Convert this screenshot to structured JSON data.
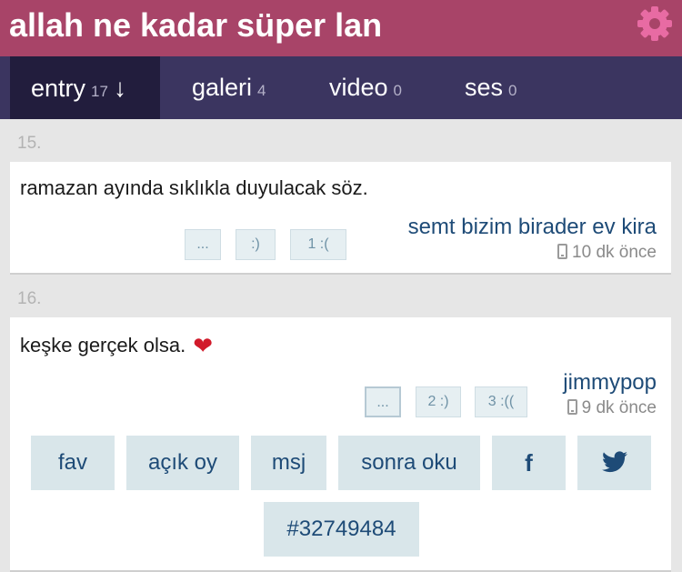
{
  "header": {
    "title": "allah ne kadar süper lan"
  },
  "tabs": [
    {
      "label": "entry",
      "count": "17",
      "arrow": "↓"
    },
    {
      "label": "galeri",
      "count": "4"
    },
    {
      "label": "video",
      "count": "0"
    },
    {
      "label": "ses",
      "count": "0"
    }
  ],
  "entries": [
    {
      "number": "15.",
      "text": "ramazan ayında sıklıkla duyulacak söz.",
      "votes": [
        "...",
        ":)",
        "1  :("
      ],
      "author": "semt bizim birader ev kira",
      "time": "10 dk önce"
    },
    {
      "number": "16.",
      "text": "keşke gerçek olsa.",
      "votes": [
        "...",
        "2 :)",
        "3 :(("
      ],
      "author": "jimmypop",
      "time": "9 dk önce",
      "actions": {
        "fav": "fav",
        "open_vote": "açık oy",
        "message": "msj",
        "read_later": "sonra oku",
        "facebook_glyph": "f",
        "entry_id": "#32749484"
      }
    }
  ],
  "colors": {
    "header_bg": "#a84468",
    "tabbar_bg": "#3b3560",
    "tab_active_bg": "#221d3d",
    "gear": "#e86ba3",
    "link": "#1e4b77"
  },
  "icons": {
    "settings": "gear-icon",
    "device": "mobile-phone-icon",
    "heart": "red-heart-emoji",
    "twitter": "twitter-bird-icon"
  }
}
